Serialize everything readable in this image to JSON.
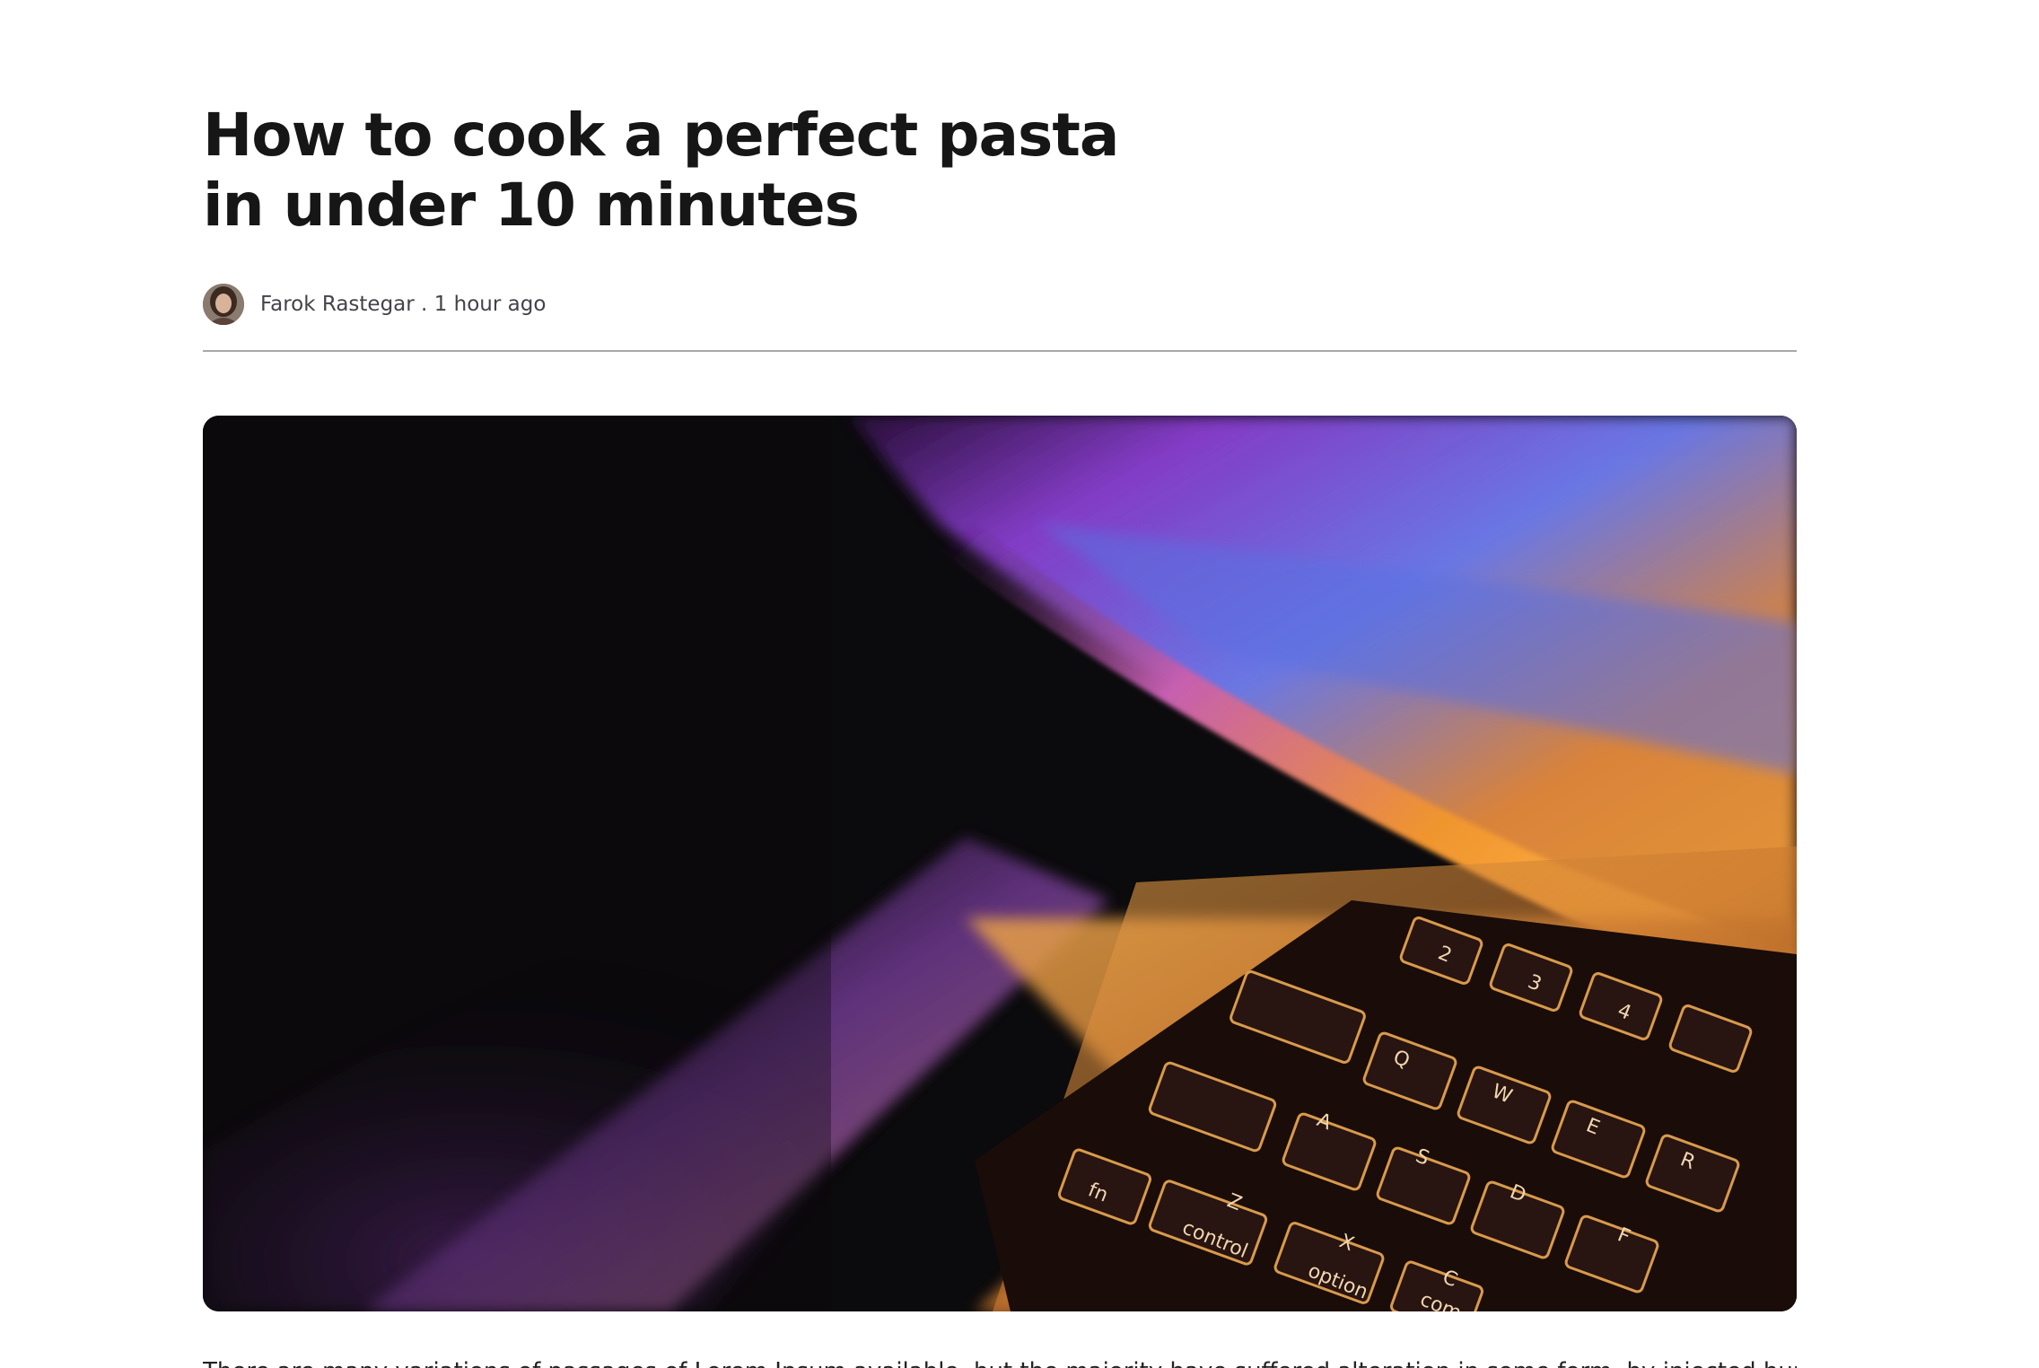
{
  "article": {
    "title": "How to cook a perfect pasta in under 10 minutes",
    "author": "Farok Rastegar",
    "separator": " . ",
    "time_ago": "1 hour ago",
    "body": "There are many variations of passages of Lorem Ipsum available, but the majority have suffered alteration in some form, by injected humour, or"
  },
  "hero_image": {
    "description_icon": "laptop-keyboard-photo",
    "keys": [
      "fn",
      "control",
      "option",
      "com",
      "A",
      "S",
      "D",
      "Q",
      "W",
      "E",
      "R",
      "Z",
      "X",
      "C",
      "F",
      "2",
      "3",
      "4"
    ]
  },
  "colors": {
    "title": "#161616",
    "meta": "#44424a",
    "divider": "#a9a9a9",
    "hero_bg": "#0b0a0c"
  }
}
